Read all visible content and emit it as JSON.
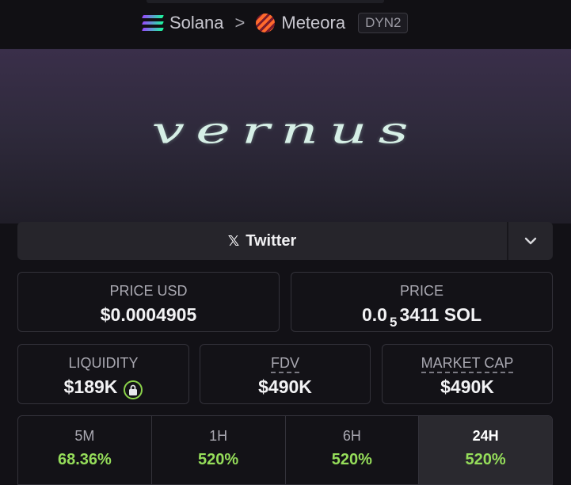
{
  "breadcrumb": {
    "chain": "Solana",
    "separator": ">",
    "dex": "Meteora",
    "badge": "DYN2"
  },
  "banner": {
    "text": "vernus"
  },
  "links": {
    "twitter_label": "Twitter",
    "dropdown_icon": "chevron-down-icon"
  },
  "metrics": {
    "price_usd": {
      "label": "PRICE USD",
      "value": "$0.0004905"
    },
    "price": {
      "label": "PRICE",
      "prefix": "0.0",
      "subscript": "5",
      "suffix": "3411 SOL"
    },
    "liquidity": {
      "label": "LIQUIDITY",
      "value": "$189K"
    },
    "fdv": {
      "label": "FDV",
      "value": "$490K"
    },
    "market_cap": {
      "label": "MARKET CAP",
      "value": "$490K"
    }
  },
  "periods": [
    {
      "label": "5M",
      "change": "68.36%"
    },
    {
      "label": "1H",
      "change": "520%"
    },
    {
      "label": "6H",
      "change": "520%"
    },
    {
      "label": "24H",
      "change": "520%"
    }
  ],
  "colors": {
    "accent_green": "#95dd5a",
    "card_bg": "#131217",
    "border": "#33323a"
  }
}
